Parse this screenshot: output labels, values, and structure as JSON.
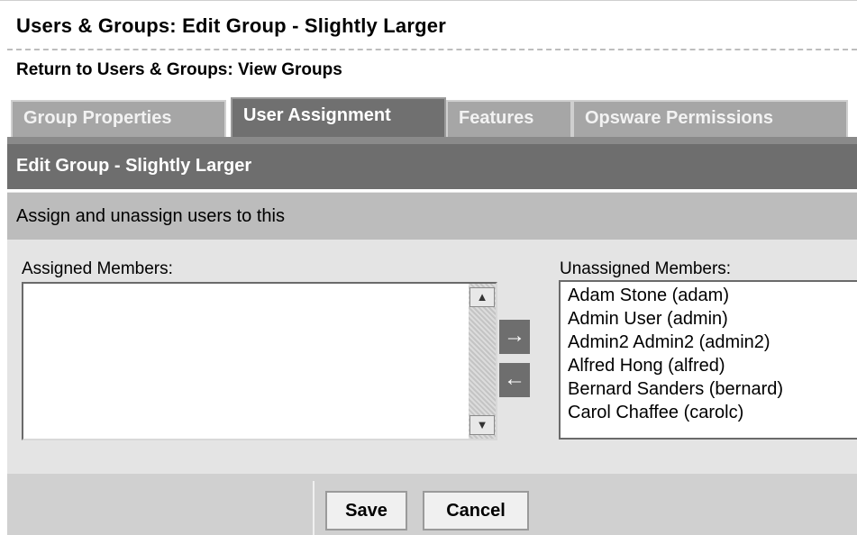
{
  "page": {
    "title": "Users & Groups: Edit Group - Slightly Larger",
    "return_prefix": "Return to",
    "return_link": "Users & Groups: View Groups"
  },
  "tabs": [
    {
      "label": "Group Properties",
      "active": false
    },
    {
      "label": "User Assignment",
      "active": true
    },
    {
      "label": "Features",
      "active": false
    },
    {
      "label": "Opsware Permissions",
      "active": false
    }
  ],
  "section": {
    "title": "Edit Group - Slightly Larger",
    "description": "Assign and unassign users to this"
  },
  "assigned": {
    "label": "Assigned Members:",
    "items": []
  },
  "unassigned": {
    "label": "Unassigned Members:",
    "items": [
      "Adam Stone (adam)",
      "Admin User (admin)",
      "Admin2 Admin2 (admin2)",
      "Alfred Hong (alfred)",
      "Bernard Sanders (bernard)",
      "Carol Chaffee (carolc)"
    ]
  },
  "transfer": {
    "add_icon": "arrow-right-icon",
    "add_glyph": "→",
    "remove_icon": "arrow-left-icon",
    "remove_glyph": "←"
  },
  "scrollbar": {
    "up_glyph": "▲",
    "down_glyph": "▼"
  },
  "actions": {
    "save_label": "Save",
    "cancel_label": "Cancel"
  },
  "colors": {
    "active_tab": "#707070",
    "inactive_tab": "#a6a6a6",
    "section_header": "#6e6e6e",
    "description_bar": "#bcbcbc"
  }
}
